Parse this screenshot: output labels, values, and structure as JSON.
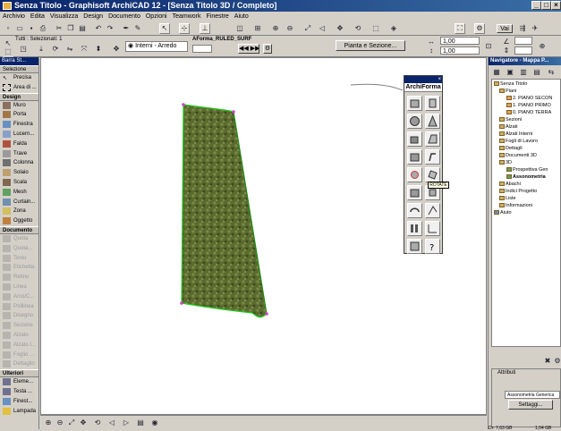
{
  "window": {
    "title": "Senza Titolo - Graphisoft ArchiCAD 12 - [Senza Titolo 3D / Completo]"
  },
  "menu": [
    "Archivio",
    "Edita",
    "Visualizza",
    "Design",
    "Documento",
    "Opzioni",
    "Teamwork",
    "Finestre",
    "Aiuto"
  ],
  "toolbar": {
    "vai_label": "Vai",
    "selection_info": "Tutti : Selezionati: 1",
    "layer_label": "Interni - Arredo",
    "object_name": "AForma_RULED_SURF",
    "nav_label": "Pianta e Sezione...",
    "value_1": "1,00",
    "value_2": "1,00"
  },
  "toolbox": {
    "header": "Barra St...",
    "selection_label": "Selezione",
    "items_top": [
      "Precisa",
      "Area di ..."
    ],
    "design_section": "Design",
    "design_tools": [
      "Muro",
      "Porta",
      "Finestra",
      "Lucern...",
      "Falda",
      "Trave",
      "Colonna",
      "Solaio",
      "Scala",
      "Mesh",
      "Curtain...",
      "Zona",
      "Oggetto"
    ],
    "documento_section": "Documento",
    "documento_tools": [
      "Quota",
      "Quota...",
      "Testo",
      "Etichetta",
      "Retino",
      "Linea",
      "Arco/C...",
      "Polilinea",
      "Disegno",
      "Sezione",
      "Alzato",
      "Alzato I...",
      "Foglio ...",
      "Dettaglio"
    ],
    "ulteriori_section": "Ulteriori",
    "ulteriori_tools": [
      "Eleme...",
      "Testa ...",
      "Finest...",
      "Lampada"
    ]
  },
  "archiform": {
    "title": "ArchiForma",
    "tooltip": "ROTATE"
  },
  "navigator": {
    "title": "Navigatore - Mappa P...",
    "tree": [
      {
        "label": "Senza Titolo",
        "level": 0
      },
      {
        "label": "Piani",
        "level": 1
      },
      {
        "label": "2. PIANO SECON",
        "level": 2
      },
      {
        "label": "1. PIANO PRIMO",
        "level": 2
      },
      {
        "label": "0. PIANO TERRA",
        "level": 2
      },
      {
        "label": "Sezioni",
        "level": 1
      },
      {
        "label": "Alzati",
        "level": 1
      },
      {
        "label": "Alzati Interni",
        "level": 1
      },
      {
        "label": "Fogli di Lavoro",
        "level": 1
      },
      {
        "label": "Dettagli",
        "level": 1
      },
      {
        "label": "Documenti 3D",
        "level": 1
      },
      {
        "label": "3D",
        "level": 1
      },
      {
        "label": "Prospettiva Gen",
        "level": 2
      },
      {
        "label": "Assonometria",
        "level": 2,
        "selected": true
      },
      {
        "label": "Abachi",
        "level": 1
      },
      {
        "label": "Indici Progetto",
        "level": 1
      },
      {
        "label": "Liste",
        "level": 1
      },
      {
        "label": "Informazioni",
        "level": 1
      },
      {
        "label": "Aiuto",
        "level": 0
      }
    ],
    "attributes_label": "Attributi",
    "view_field": "Assonometria Generica",
    "settings_button": "Settaggi..."
  },
  "status": {
    "left_value": "Dr: 7,63 GB",
    "right_value": "1,04 GB"
  },
  "colors": {
    "surface_green": "#5a6b2e",
    "edge_green": "#22cc22",
    "titlebar": "#0a246a"
  }
}
